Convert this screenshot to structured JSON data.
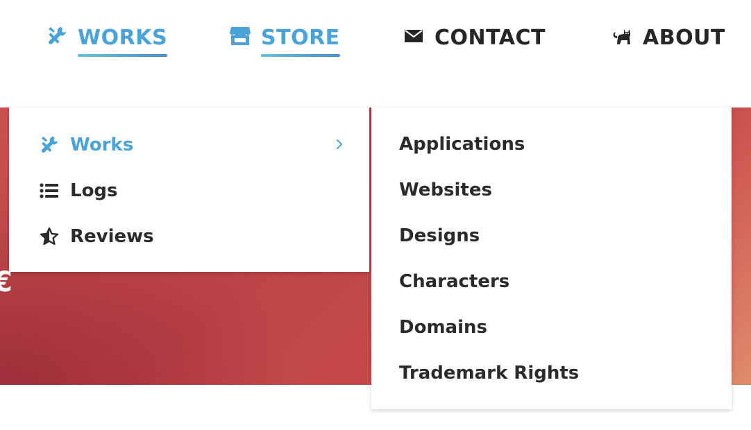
{
  "topnav": {
    "items": [
      {
        "label": "WORKS",
        "icon": "tools-icon",
        "active": true
      },
      {
        "label": "STORE",
        "icon": "store-icon",
        "active": true
      },
      {
        "label": "CONTACT",
        "icon": "envelope-icon",
        "active": false
      },
      {
        "label": "ABOUT",
        "icon": "cat-icon",
        "active": false
      }
    ]
  },
  "colors": {
    "accent": "#4aa3d8",
    "underline_start": "#5fc1da",
    "underline_end": "#4a90d0",
    "text_dark": "#262626",
    "hero_red": "#c24a4a",
    "hero_orange": "#e08b6c"
  },
  "dropdown": {
    "primary": [
      {
        "label": "Works",
        "icon": "tools-icon",
        "active": true,
        "has_submenu": true
      },
      {
        "label": "Logs",
        "icon": "list-icon",
        "active": false
      },
      {
        "label": "Reviews",
        "icon": "star-half-icon",
        "active": false
      }
    ],
    "submenu": [
      "Applications",
      "Websites",
      "Designs",
      "Characters",
      "Domains",
      "Trademark Rights"
    ]
  }
}
